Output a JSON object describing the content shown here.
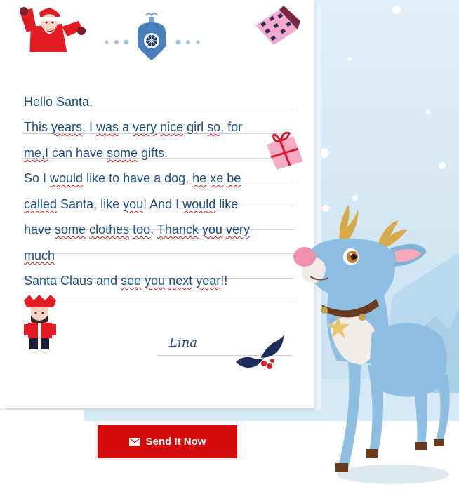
{
  "letter": {
    "lines": [
      {
        "segments": [
          {
            "t": "Hello Santa,",
            "s": false
          }
        ]
      },
      {
        "segments": [
          {
            "t": "This ",
            "s": false
          },
          {
            "t": "years",
            "s": true
          },
          {
            "t": ", I ",
            "s": false
          },
          {
            "t": "was",
            "s": true
          },
          {
            "t": " a ",
            "s": false
          },
          {
            "t": "very",
            "s": true
          },
          {
            "t": " ",
            "s": false
          },
          {
            "t": "nice",
            "s": true
          },
          {
            "t": " girl ",
            "s": false
          },
          {
            "t": "so",
            "s": true
          },
          {
            "t": ", for",
            "s": false
          }
        ]
      },
      {
        "segments": [
          {
            "t": "me,I",
            "s": true
          },
          {
            "t": " can have ",
            "s": false
          },
          {
            "t": "some",
            "s": true
          },
          {
            "t": " gifts.",
            "s": false
          }
        ]
      },
      {
        "segments": [
          {
            "t": "So I ",
            "s": false
          },
          {
            "t": "would",
            "s": true
          },
          {
            "t": " like to have a dog, ",
            "s": false
          },
          {
            "t": "he",
            "s": true
          },
          {
            "t": " ",
            "s": false
          },
          {
            "t": "xe",
            "s": true
          },
          {
            "t": " ",
            "s": false
          },
          {
            "t": "be",
            "s": true
          }
        ]
      },
      {
        "segments": [
          {
            "t": "called",
            "s": true
          },
          {
            "t": " Santa, like ",
            "s": false
          },
          {
            "t": "you",
            "s": true
          },
          {
            "t": "! And I ",
            "s": false
          },
          {
            "t": "would",
            "s": true
          },
          {
            "t": " like",
            "s": false
          }
        ]
      },
      {
        "segments": [
          {
            "t": "have ",
            "s": false
          },
          {
            "t": "some",
            "s": true
          },
          {
            "t": " ",
            "s": false
          },
          {
            "t": "clothes",
            "s": true
          },
          {
            "t": " ",
            "s": false
          },
          {
            "t": "too",
            "s": true
          },
          {
            "t": ". ",
            "s": false
          },
          {
            "t": "Thanck",
            "s": true
          },
          {
            "t": " ",
            "s": false
          },
          {
            "t": "you",
            "s": true
          },
          {
            "t": " ",
            "s": false
          },
          {
            "t": "very",
            "s": true
          }
        ]
      },
      {
        "segments": [
          {
            "t": "much",
            "s": true
          }
        ]
      },
      {
        "segments": [
          {
            "t": "Santa Claus and ",
            "s": false
          },
          {
            "t": "see",
            "s": true
          },
          {
            "t": " ",
            "s": false
          },
          {
            "t": "you",
            "s": true
          },
          {
            "t": " ",
            "s": false
          },
          {
            "t": "next",
            "s": true
          },
          {
            "t": " ",
            "s": false
          },
          {
            "t": "year",
            "s": true
          },
          {
            "t": "!!",
            "s": false
          }
        ]
      }
    ],
    "signature": "Lina"
  },
  "send_button": {
    "label": "Send It Now",
    "icon": "envelope-icon"
  },
  "colors": {
    "text": "#1f4e84",
    "button": "#d60a0a",
    "sky": "#d3e7f4",
    "spellcheck": "#d21f1f"
  },
  "icons": [
    "santa-icon",
    "ornament-icon",
    "house-icon",
    "gift-icon",
    "nutcracker-icon",
    "holly-icon",
    "reindeer-illustration"
  ]
}
